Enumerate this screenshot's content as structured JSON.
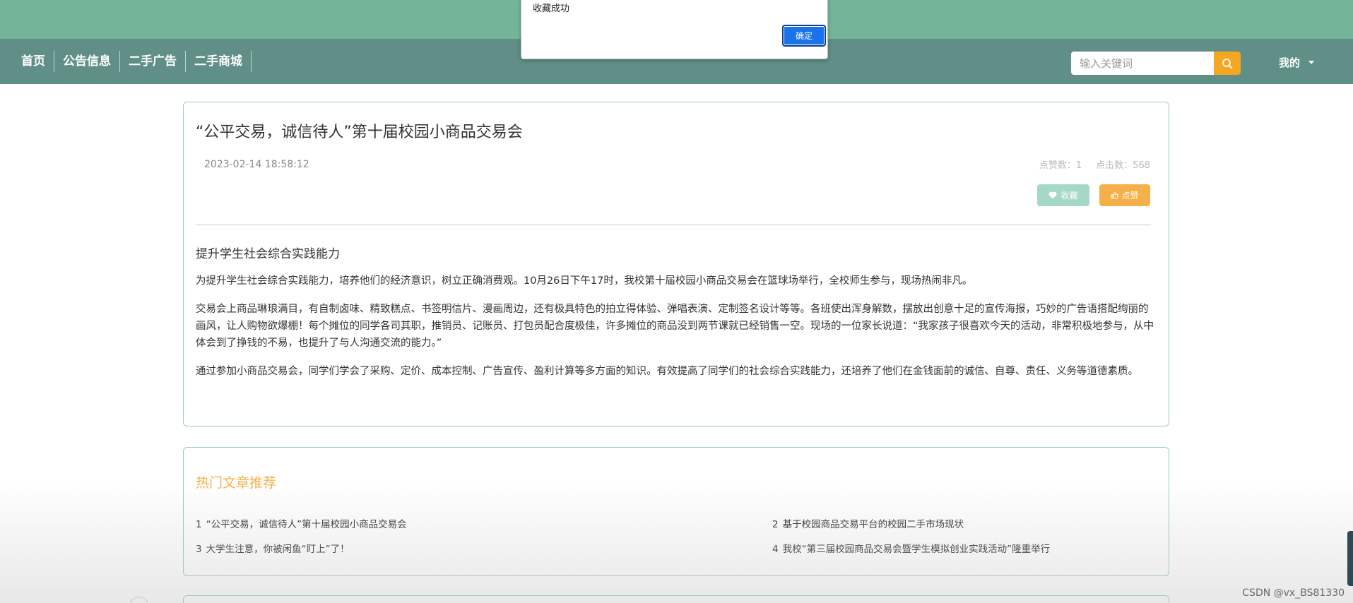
{
  "nav": {
    "items": [
      {
        "label": "首页"
      },
      {
        "label": "公告信息"
      },
      {
        "label": "二手广告"
      },
      {
        "label": "二手商城"
      }
    ],
    "search_placeholder": "输入关键词",
    "user_label": "我的"
  },
  "alert": {
    "message": "收藏成功",
    "ok_label": "确定"
  },
  "article": {
    "title": "“公平交易，诚信待人”第十届校园小商品交易会",
    "date": "2023-02-14 18:58:12",
    "likes_label": "点赞数：1",
    "clicks_label": "点击数：568",
    "fav_label": "收藏",
    "like_label": "点赞",
    "subtitle": "提升学生社会综合实践能力",
    "paragraphs": [
      "为提升学生社会综合实践能力，培养他们的经济意识，树立正确消费观。10月26日下午17时，我校第十届校园小商品交易会在篮球场举行，全校师生参与，现场热闹非凡。",
      "交易会上商品琳琅满目，有自制卤味、精致糕点、书签明信片、漫画周边，还有极具特色的拍立得体验、弹唱表演、定制签名设计等等。各班使出浑身解数，摆放出创意十足的宣传海报，巧妙的广告语搭配绚丽的画风，让人购物欲爆棚！每个摊位的同学各司其职，推销员、记账员、打包员配合度极佳，许多摊位的商品没到两节课就已经销售一空。现场的一位家长说道：“我家孩子很喜欢今天的活动，非常积极地参与，从中体会到了挣钱的不易，也提升了与人沟通交流的能力。”",
      "通过参加小商品交易会，同学们学会了采购、定价、成本控制、广告宣传、盈利计算等多方面的知识。有效提高了同学们的社会综合实践能力，还培养了他们在金钱面前的诚信、自尊、责任、义务等道德素质。"
    ]
  },
  "hot": {
    "title": "热门文章推荐",
    "items": [
      {
        "num": "1",
        "text": "“公平交易，诚信待人”第十届校园小商品交易会"
      },
      {
        "num": "2",
        "text": "基于校园商品交易平台的校园二手市场现状"
      },
      {
        "num": "3",
        "text": "大学生注意，你被闲鱼“盯上”了！"
      },
      {
        "num": "4",
        "text": "我校“第三届校园商品交易会暨学生模拟创业实践活动”隆重举行"
      }
    ]
  },
  "footer": {
    "watermark": "CSDN @vx_BS81330"
  },
  "colors": {
    "topbar": "#74b59a",
    "navbar": "#5f8f86",
    "accent_orange": "#f5a623",
    "fav_button": "#a6d8c8",
    "card_border": "#9cc9bd"
  }
}
